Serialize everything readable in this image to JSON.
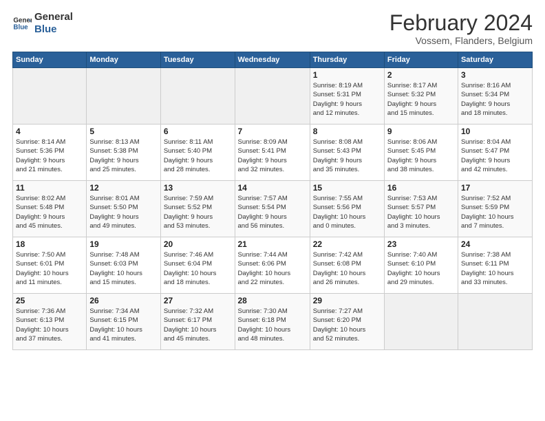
{
  "logo": {
    "line1": "General",
    "line2": "Blue"
  },
  "title": "February 2024",
  "subtitle": "Vossem, Flanders, Belgium",
  "days_of_week": [
    "Sunday",
    "Monday",
    "Tuesday",
    "Wednesday",
    "Thursday",
    "Friday",
    "Saturday"
  ],
  "weeks": [
    [
      {
        "day": "",
        "info": ""
      },
      {
        "day": "",
        "info": ""
      },
      {
        "day": "",
        "info": ""
      },
      {
        "day": "",
        "info": ""
      },
      {
        "day": "1",
        "info": "Sunrise: 8:19 AM\nSunset: 5:31 PM\nDaylight: 9 hours\nand 12 minutes."
      },
      {
        "day": "2",
        "info": "Sunrise: 8:17 AM\nSunset: 5:32 PM\nDaylight: 9 hours\nand 15 minutes."
      },
      {
        "day": "3",
        "info": "Sunrise: 8:16 AM\nSunset: 5:34 PM\nDaylight: 9 hours\nand 18 minutes."
      }
    ],
    [
      {
        "day": "4",
        "info": "Sunrise: 8:14 AM\nSunset: 5:36 PM\nDaylight: 9 hours\nand 21 minutes."
      },
      {
        "day": "5",
        "info": "Sunrise: 8:13 AM\nSunset: 5:38 PM\nDaylight: 9 hours\nand 25 minutes."
      },
      {
        "day": "6",
        "info": "Sunrise: 8:11 AM\nSunset: 5:40 PM\nDaylight: 9 hours\nand 28 minutes."
      },
      {
        "day": "7",
        "info": "Sunrise: 8:09 AM\nSunset: 5:41 PM\nDaylight: 9 hours\nand 32 minutes."
      },
      {
        "day": "8",
        "info": "Sunrise: 8:08 AM\nSunset: 5:43 PM\nDaylight: 9 hours\nand 35 minutes."
      },
      {
        "day": "9",
        "info": "Sunrise: 8:06 AM\nSunset: 5:45 PM\nDaylight: 9 hours\nand 38 minutes."
      },
      {
        "day": "10",
        "info": "Sunrise: 8:04 AM\nSunset: 5:47 PM\nDaylight: 9 hours\nand 42 minutes."
      }
    ],
    [
      {
        "day": "11",
        "info": "Sunrise: 8:02 AM\nSunset: 5:48 PM\nDaylight: 9 hours\nand 45 minutes."
      },
      {
        "day": "12",
        "info": "Sunrise: 8:01 AM\nSunset: 5:50 PM\nDaylight: 9 hours\nand 49 minutes."
      },
      {
        "day": "13",
        "info": "Sunrise: 7:59 AM\nSunset: 5:52 PM\nDaylight: 9 hours\nand 53 minutes."
      },
      {
        "day": "14",
        "info": "Sunrise: 7:57 AM\nSunset: 5:54 PM\nDaylight: 9 hours\nand 56 minutes."
      },
      {
        "day": "15",
        "info": "Sunrise: 7:55 AM\nSunset: 5:56 PM\nDaylight: 10 hours\nand 0 minutes."
      },
      {
        "day": "16",
        "info": "Sunrise: 7:53 AM\nSunset: 5:57 PM\nDaylight: 10 hours\nand 3 minutes."
      },
      {
        "day": "17",
        "info": "Sunrise: 7:52 AM\nSunset: 5:59 PM\nDaylight: 10 hours\nand 7 minutes."
      }
    ],
    [
      {
        "day": "18",
        "info": "Sunrise: 7:50 AM\nSunset: 6:01 PM\nDaylight: 10 hours\nand 11 minutes."
      },
      {
        "day": "19",
        "info": "Sunrise: 7:48 AM\nSunset: 6:03 PM\nDaylight: 10 hours\nand 15 minutes."
      },
      {
        "day": "20",
        "info": "Sunrise: 7:46 AM\nSunset: 6:04 PM\nDaylight: 10 hours\nand 18 minutes."
      },
      {
        "day": "21",
        "info": "Sunrise: 7:44 AM\nSunset: 6:06 PM\nDaylight: 10 hours\nand 22 minutes."
      },
      {
        "day": "22",
        "info": "Sunrise: 7:42 AM\nSunset: 6:08 PM\nDaylight: 10 hours\nand 26 minutes."
      },
      {
        "day": "23",
        "info": "Sunrise: 7:40 AM\nSunset: 6:10 PM\nDaylight: 10 hours\nand 29 minutes."
      },
      {
        "day": "24",
        "info": "Sunrise: 7:38 AM\nSunset: 6:11 PM\nDaylight: 10 hours\nand 33 minutes."
      }
    ],
    [
      {
        "day": "25",
        "info": "Sunrise: 7:36 AM\nSunset: 6:13 PM\nDaylight: 10 hours\nand 37 minutes."
      },
      {
        "day": "26",
        "info": "Sunrise: 7:34 AM\nSunset: 6:15 PM\nDaylight: 10 hours\nand 41 minutes."
      },
      {
        "day": "27",
        "info": "Sunrise: 7:32 AM\nSunset: 6:17 PM\nDaylight: 10 hours\nand 45 minutes."
      },
      {
        "day": "28",
        "info": "Sunrise: 7:30 AM\nSunset: 6:18 PM\nDaylight: 10 hours\nand 48 minutes."
      },
      {
        "day": "29",
        "info": "Sunrise: 7:27 AM\nSunset: 6:20 PM\nDaylight: 10 hours\nand 52 minutes."
      },
      {
        "day": "",
        "info": ""
      },
      {
        "day": "",
        "info": ""
      }
    ]
  ]
}
